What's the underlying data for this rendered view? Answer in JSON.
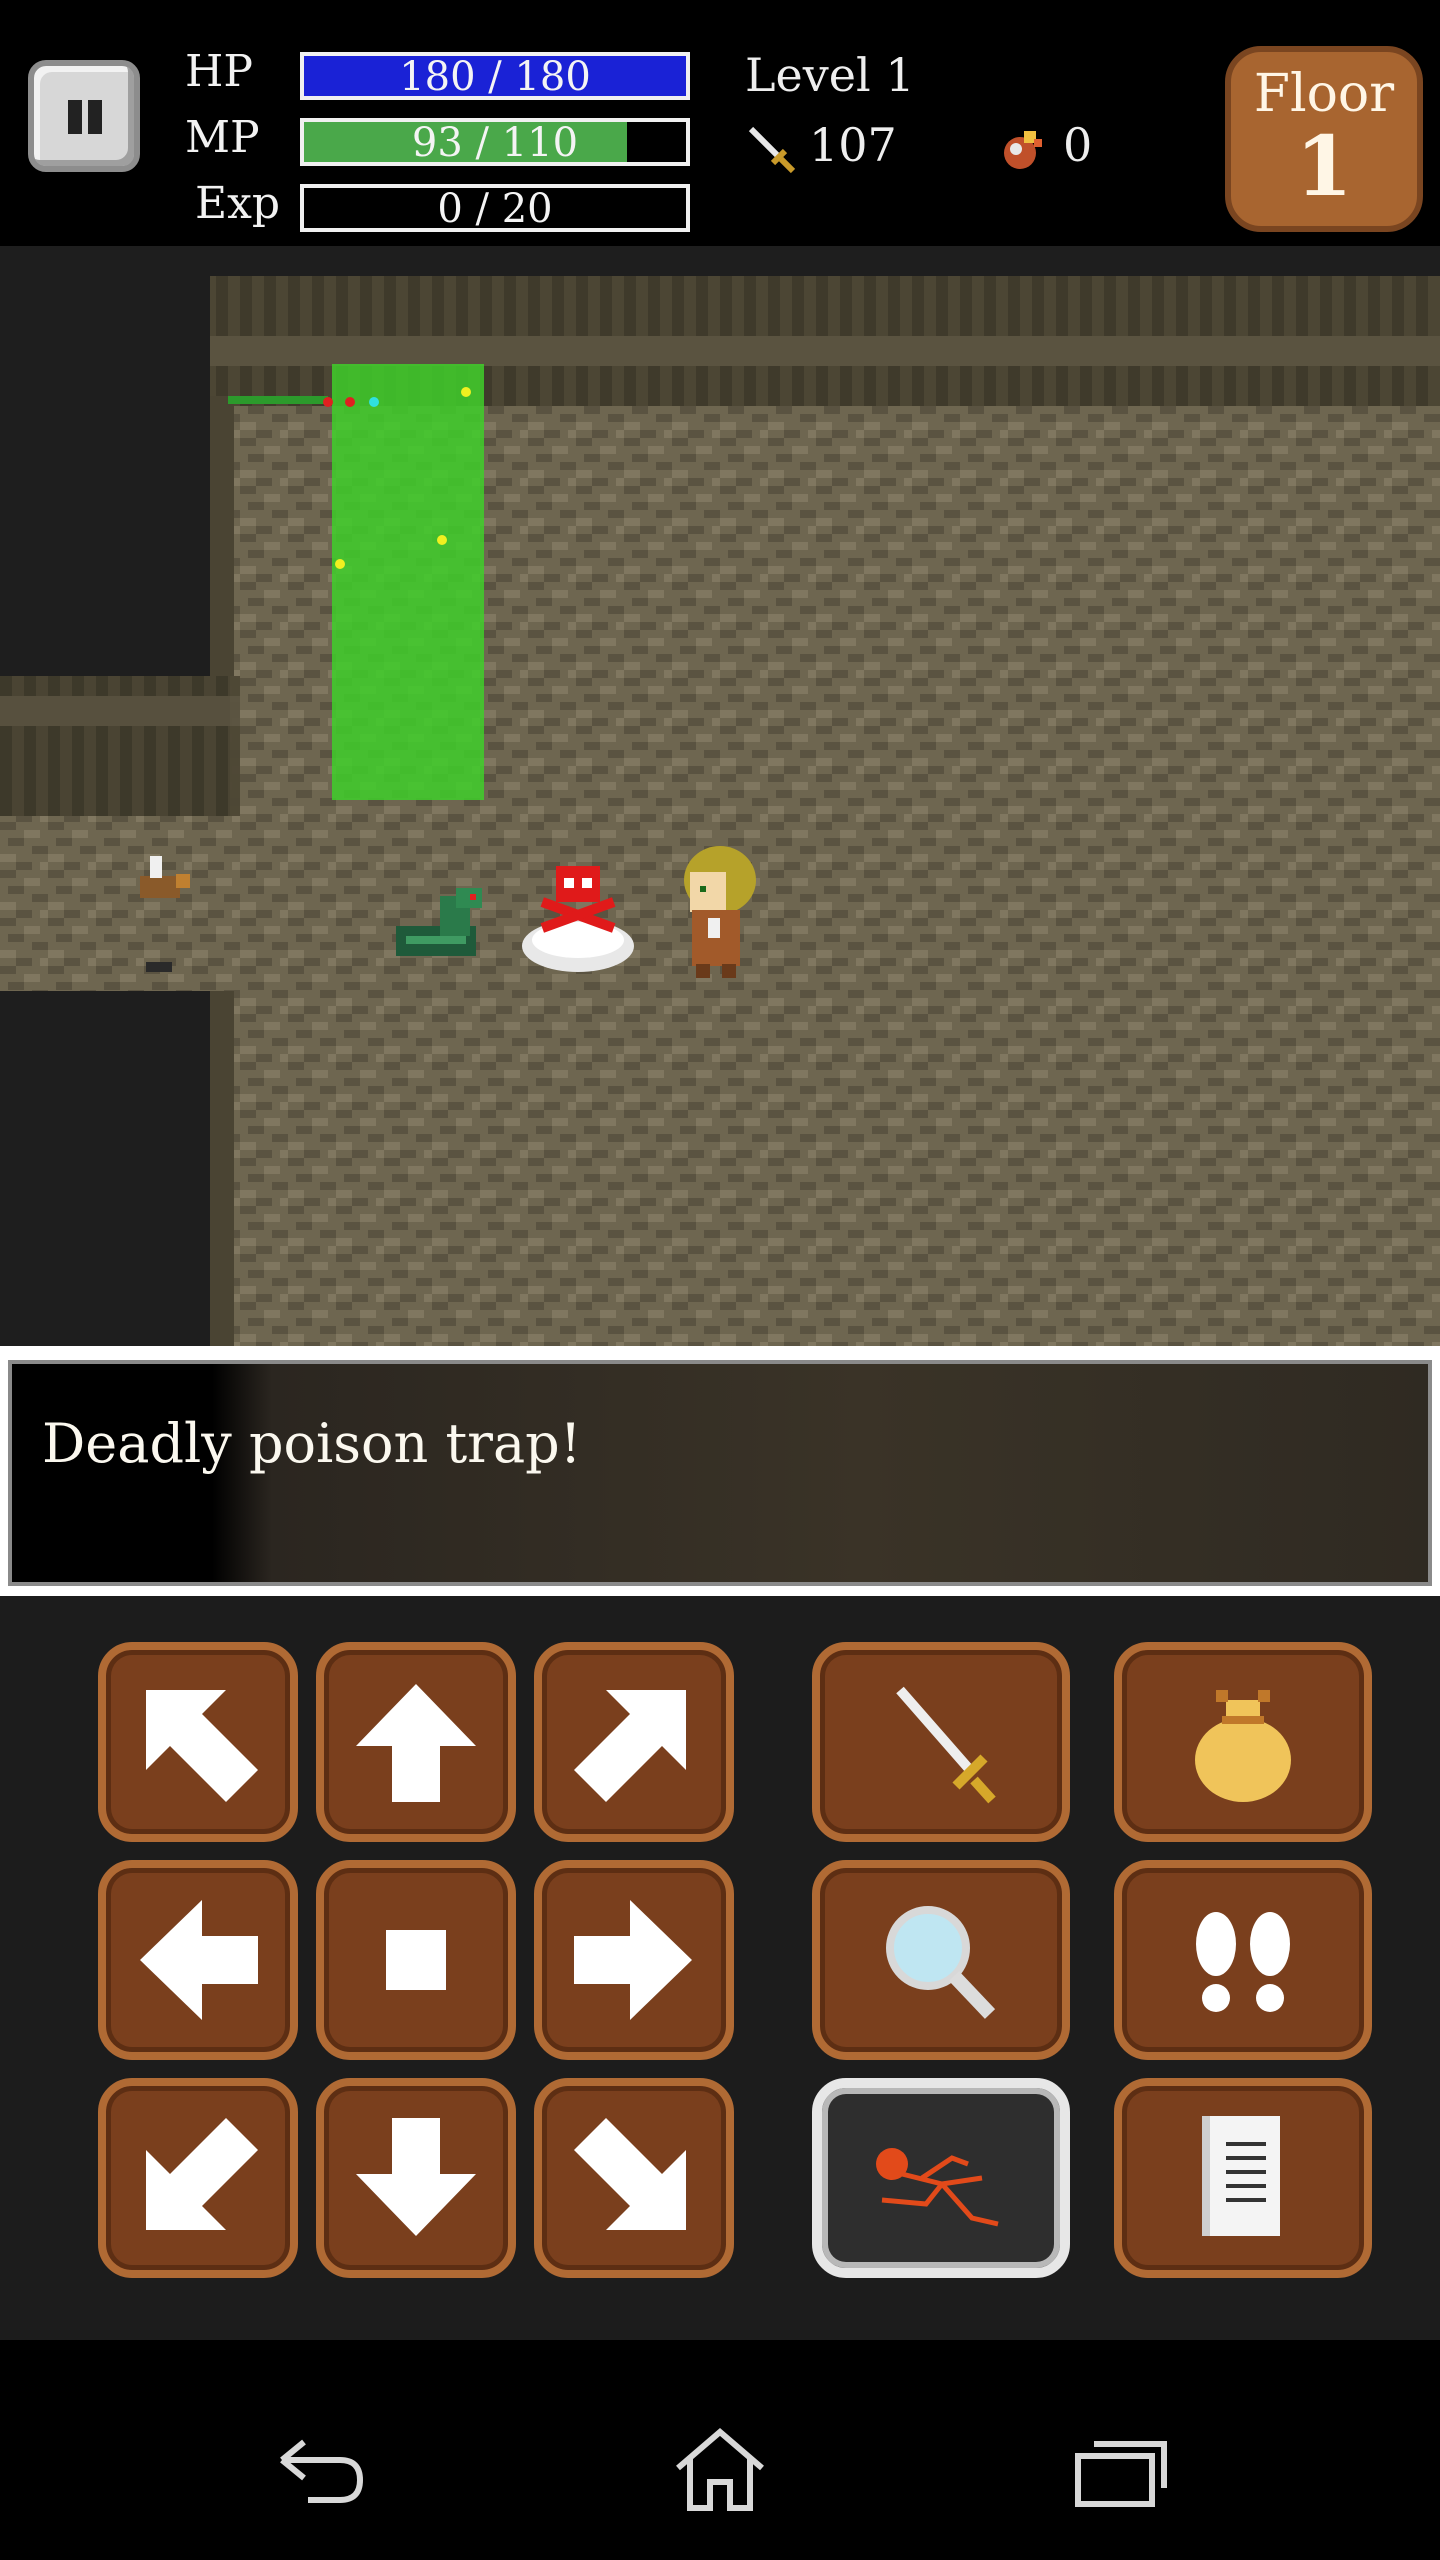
{
  "hud": {
    "hp_label": "HP",
    "hp_text": "180 / 180",
    "hp_fraction": 1.0,
    "mp_label": "MP",
    "mp_text": "93 / 110",
    "mp_fraction": 0.845,
    "exp_label": "Exp",
    "exp_text": "0 / 20",
    "exp_fraction": 0.0,
    "level_text": "Level 1",
    "attack_value": "107",
    "gold_value": "0",
    "floor_label": "Floor",
    "floor_number": "1"
  },
  "colors": {
    "hp_bar": "#1a22d6",
    "mp_bar": "#4aa84a",
    "button_fill": "#7a3f1d",
    "button_border": "#b06a34",
    "floor_badge": "#a86530"
  },
  "message": {
    "text": "Deadly poison trap!"
  },
  "controls": {
    "move_buttons": [
      "arrow-up-left-icon",
      "arrow-up-icon",
      "arrow-up-right-icon",
      "arrow-left-icon",
      "wait-square-icon",
      "arrow-right-icon",
      "arrow-down-left-icon",
      "arrow-down-icon",
      "arrow-down-right-icon"
    ],
    "action_buttons": [
      "sword-icon",
      "bag-icon",
      "magnifier-icon",
      "footprints-icon",
      "dash-runner-icon",
      "scroll-log-icon"
    ],
    "selected_action": "dash-runner-icon"
  },
  "navbar": [
    "back-icon",
    "home-icon",
    "recents-icon"
  ]
}
